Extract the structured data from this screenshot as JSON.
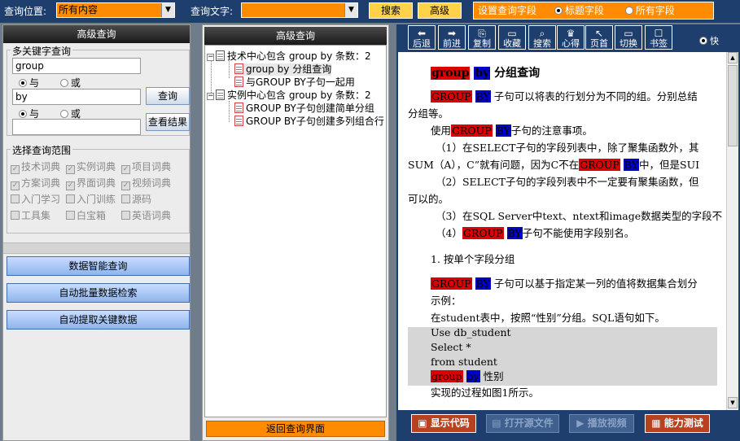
{
  "topbar": {
    "location_label": "查询位置:",
    "location_value": "所有内容",
    "text_label": "查询文字:",
    "text_value": "",
    "search_btn": "搜索",
    "advanced_btn": "高级",
    "set_fields_label": "设置查询字段",
    "opt_title": "标题字段",
    "opt_all": "所有字段"
  },
  "left": {
    "header": "高级查询",
    "multi_kw_title": "多关键字查询",
    "kw1": "group",
    "and": "与",
    "or": "或",
    "kw2": "by",
    "kw3": "",
    "query_btn": "查询",
    "view_results_btn": "查看结果",
    "scope_title": "选择查询范围",
    "scope_items": [
      "技术词典",
      "实例词典",
      "项目词典",
      "方案词典",
      "界面词典",
      "视频词典",
      "入门学习",
      "入门训练",
      "源码",
      "工具集",
      "白宝箱",
      "英语词典"
    ],
    "smart_btn": "数据智能查询",
    "batch_btn": "自动批量数据检索",
    "extract_btn": "自动提取关键数据"
  },
  "mid": {
    "header": "高级查询",
    "tree": [
      {
        "label": "技术中心包含 group by  条数：2",
        "children": [
          "group by 分组查询",
          "与GROUP BY子句一起用"
        ]
      },
      {
        "label": "实例中心包含 group by  条数：2",
        "children": [
          "GROUP BY子句创建简单分组",
          "GROUP BY子句创建多列组合行"
        ]
      }
    ],
    "back_btn": "返回查询界面"
  },
  "right": {
    "toolbar": [
      {
        "icon": "⬅",
        "label": "后退"
      },
      {
        "icon": "➡",
        "label": "前进"
      },
      {
        "icon": "⎘",
        "label": "复制"
      },
      {
        "icon": "▭",
        "label": "收藏"
      },
      {
        "icon": "⌕",
        "label": "搜索"
      },
      {
        "icon": "♛",
        "label": "心得"
      },
      {
        "icon": "↖",
        "label": "页首"
      },
      {
        "icon": "▭",
        "label": "切换"
      },
      {
        "icon": "☐",
        "label": "书签"
      }
    ],
    "toolbar_option": "快",
    "content": {
      "title_rest": " 分组查询",
      "p1_rest": " 子句可以将表的行划分为不同的组。分别总结",
      "p1_cont": "分组等。",
      "p2_pre": "使用",
      "p2_post": "子句的注意事项。",
      "p3": "（1）在SELECT子句的字段列表中，除了聚集函数外，其",
      "p3_cont_pre": "SUM（A），C”就有问题，因为C不在",
      "p3_cont_mid": "中，但是SUI",
      "p4": "（2）SELECT子句的字段列表中不一定要有聚集函数，但",
      "p4_cont": "可以的。",
      "p5": "（3）在SQL Server中text、ntext和image数据类型的字段不",
      "p6_pre": "（4）",
      "p6_post": "子句不能使用字段别名。",
      "section": "1. 按单个字段分组",
      "p7_post": " 子句可以基于指定某一列的值将数据集合划分",
      "p7_cont": "示例：",
      "p8": "在student表中，按照“性别”分组。SQL语句如下。",
      "code1": "Use db_student",
      "code2": "Select *",
      "code3": "from student",
      "code4_post": " 性别",
      "p9": "实现的过程如图1所示。",
      "kw_group_lower": "group",
      "kw_group_upper": "GROUP",
      "kw_by_lower": "by",
      "kw_by_upper": "BY"
    },
    "bottom": {
      "show_code": "显示代码",
      "open_source": "打开源文件",
      "play_video": "播放视频",
      "ability_test": "能力测试"
    }
  }
}
